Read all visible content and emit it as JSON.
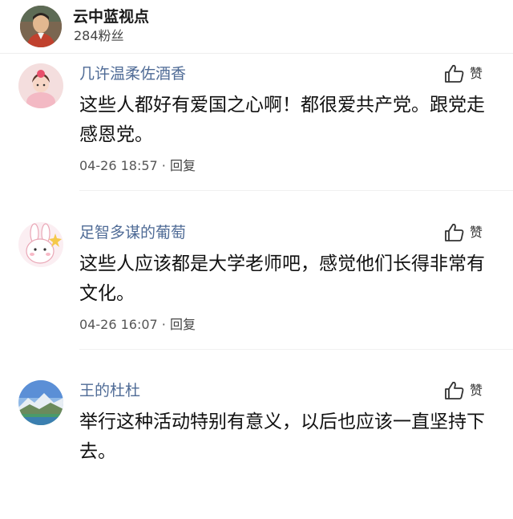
{
  "header": {
    "author_name": "云中蓝视点",
    "fans_count": "284粉丝",
    "avatar_icon": "author-avatar-photo"
  },
  "comments": [
    {
      "username": "几许温柔佐酒香",
      "text": "这些人都好有爱国之心啊！都很爱共产党。跟党走感恩党。",
      "time": "04-26 18:57",
      "separator": "·",
      "reply_label": "回复",
      "like_label": "赞",
      "avatar_icon": "girl-avatar"
    },
    {
      "username": "足智多谋的葡萄",
      "text": "这些人应该都是大学老师吧，感觉他们长得非常有文化。",
      "time": "04-26 16:07",
      "separator": "·",
      "reply_label": "回复",
      "like_label": "赞",
      "avatar_icon": "bunny-avatar"
    },
    {
      "username": "王的杜杜",
      "text": "举行这种活动特别有意义，以后也应该一直坚持下去。",
      "time": "",
      "separator": "",
      "reply_label": "",
      "like_label": "赞",
      "avatar_icon": "landscape-avatar"
    }
  ]
}
